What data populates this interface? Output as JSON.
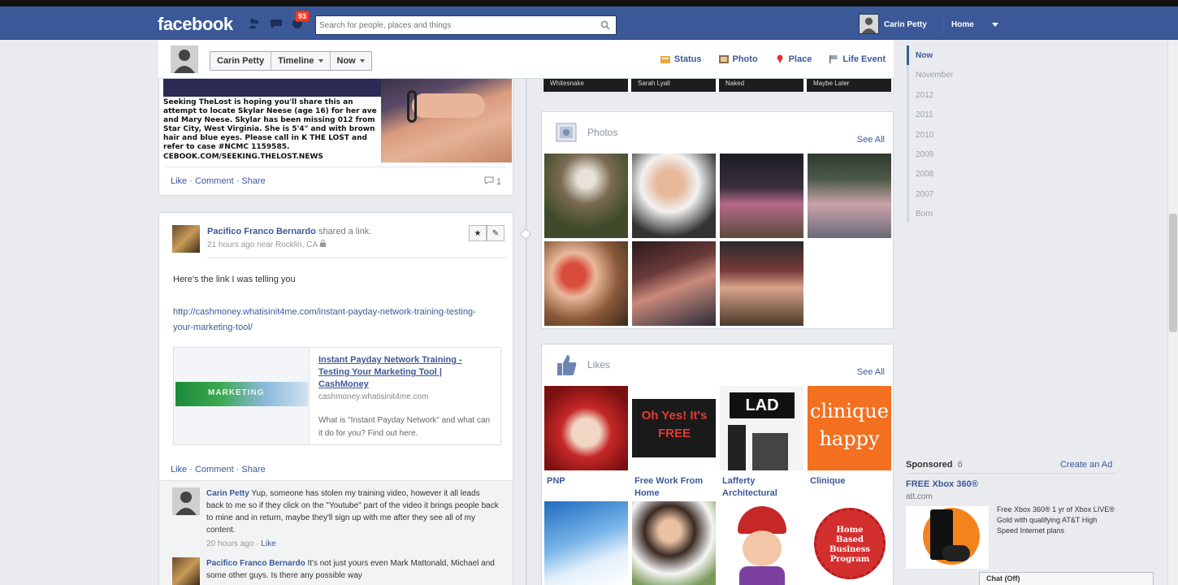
{
  "topbar": {
    "logo": "facebook",
    "notification_count": "93",
    "search_placeholder": "Search for people, places and things",
    "user_name": "Carin Petty",
    "home_label": "Home"
  },
  "timeline_header": {
    "name_label": "Carin Petty",
    "timeline_label": "Timeline",
    "now_label": "Now",
    "actions": [
      "Status",
      "Photo",
      "Place",
      "Life Event"
    ]
  },
  "post1": {
    "image_text": "Seeking TheLost is hoping you'll share this an attempt to locate Skylar Neese (age 16) for her ave and Mary Neese. Skylar has been missing 012 from Star City, West Virginia. She is 5'4\" and with brown hair and blue eyes. Please call in K THE LOST and refer to case #NCMC 1159585.",
    "image_footer": "CEBOOK.COM/SEEKING.THELOST.NEWS",
    "actions": "Like · Comment · Share",
    "share_count": "1"
  },
  "post2": {
    "author": "Pacifico Franco Bernardo",
    "shared": "shared a link.",
    "meta": "21 hours ago near Rocklin, CA",
    "text": "Here's the link I was telling you",
    "link": "http://cashmoney.whatisinit4me.com/instant-payday-network-training-testing-your-marketing-tool/",
    "attachment": {
      "sign_text": "MARKETING",
      "title": "Instant Payday Network Training - Testing Your Marketing Tool | CashMoney",
      "url": "cashmoney.whatisinit4me.com",
      "desc": "What is \"Instant Payday Network\" and what can it do for you? Find out here."
    },
    "actions": "Like · Comment · Share",
    "comments": [
      {
        "author": "Carin Petty",
        "text": "Yup, someone has stolen my training video, however it all leads back to me so if they click on the \"Youtube\" part of the video it brings people back to mine and in return, maybe they'll sign up with me after they see all of my content.",
        "time": "20 hours ago",
        "like": "Like"
      },
      {
        "author": "Pacifico Franco Bernardo",
        "text": "It's not just yours even Mark Mattonald, Michael and some other guys. Is there any possible way"
      }
    ]
  },
  "top_strip": [
    "Whitesnake",
    "Sarah Lyall",
    "Naked",
    "Maybe Later"
  ],
  "photos_card": {
    "title": "Photos",
    "see_all": "See All"
  },
  "likes_card": {
    "title": "Likes",
    "see_all": "See All",
    "tiles": [
      {
        "label": "PNP",
        "text": ""
      },
      {
        "label": "Free Work From Home",
        "text": "Oh Yes! It's FREE"
      },
      {
        "label": "Lafferty Architectural",
        "text": "LAD"
      },
      {
        "label": "Clinique",
        "text": "clinique happy"
      },
      {
        "label": "",
        "text": ""
      },
      {
        "label": "",
        "text": ""
      },
      {
        "label": "",
        "text": ""
      },
      {
        "label": "",
        "text": "Home Based Business Program"
      }
    ]
  },
  "timeline_nav": [
    "Now",
    "November",
    "2012",
    "2011",
    "2010",
    "2009",
    "2008",
    "2007",
    "Born"
  ],
  "sponsored": {
    "heading": "Sponsored",
    "count": "  6",
    "create_ad": "Create an Ad",
    "ad_title": "FREE Xbox 360®",
    "ad_domain": "att.com",
    "ad_desc": "Free Xbox 360® 1 yr of Xbox LIVE® Gold with qualifying AT&T High Speed Internet plans"
  },
  "chat": "Chat (Off)"
}
